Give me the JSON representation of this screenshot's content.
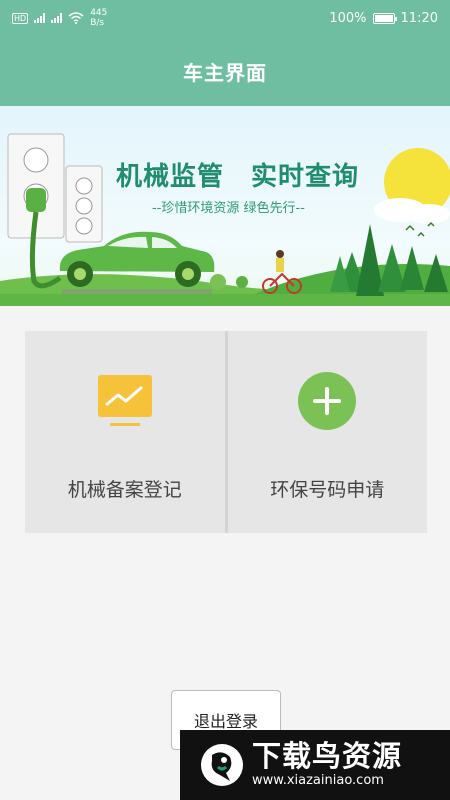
{
  "status_bar": {
    "network_left": "HD",
    "net_speed_value": "445",
    "net_speed_unit": "B/s",
    "battery": "100%",
    "time": "11:20",
    "icons": [
      "hd-icon",
      "signal-3g-icon",
      "signal-4g-icon",
      "wifi-icon",
      "battery-icon"
    ]
  },
  "header": {
    "title": "车主界面"
  },
  "banner": {
    "title": "机械监管　实时查询",
    "subtitle": "--珍惜环境资源  绿色先行--"
  },
  "tiles": [
    {
      "label": "机械备案登记",
      "icon": "chart-monitor-icon",
      "color": "#f6c23a"
    },
    {
      "label": "环保号码申请",
      "icon": "plus-circle-icon",
      "color": "#7cc156"
    }
  ],
  "logout": {
    "label": "退出登录"
  },
  "watermark": {
    "title": "下载鸟资源",
    "url": "www.xiazainiao.com"
  },
  "colors": {
    "primary": "#6fbea1",
    "banner_text": "#1f8d6e",
    "tile_bg": "#e6e6e6"
  }
}
